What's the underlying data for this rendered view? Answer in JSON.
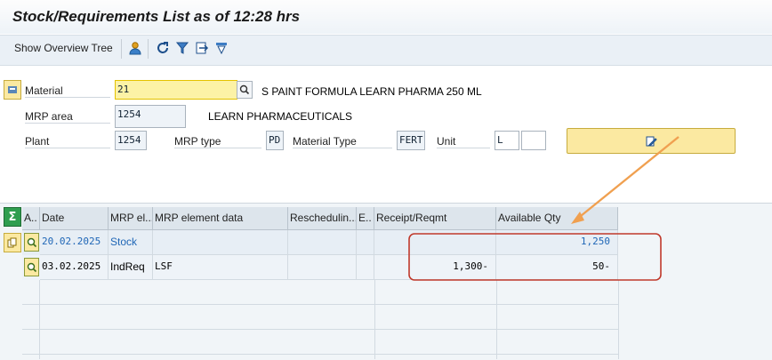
{
  "window": {
    "title": "Stock/Requirements List as of 12:28 hrs"
  },
  "toolbar": {
    "overview_tree_label": "Show Overview Tree",
    "icons": [
      "person-icon",
      "refresh-icon",
      "filter-icon",
      "export-icon",
      "settings-icon"
    ]
  },
  "header": {
    "material_label": "Material",
    "material_value": "21",
    "material_description": "S PAINT FORMULA LEARN PHARMA 250 ML",
    "mrp_area_label": "MRP area",
    "mrp_area_value": "1254",
    "mrp_area_description": "LEARN PHARMACEUTICALS",
    "plant_label": "Plant",
    "plant_value": "1254",
    "mrp_type_label": "MRP type",
    "mrp_type_value": "PD",
    "material_type_label": "Material Type",
    "material_type_value": "FERT",
    "unit_label": "Unit",
    "unit_value": "L",
    "unit_extra_value": ""
  },
  "table": {
    "columns": [
      "A..",
      "Date",
      "MRP el...",
      "MRP element data",
      "Reschedulin...",
      "E..",
      "Receipt/Reqmt",
      "Available Qty"
    ],
    "rows": [
      {
        "date": "20.02.2025",
        "mrp_element": "Stock",
        "element_data": "",
        "rescheduling": "",
        "exception": "",
        "receipt_reqmt": "",
        "available_qty": "1,250"
      },
      {
        "date": "03.02.2025",
        "mrp_element": "IndReq",
        "element_data": "LSF",
        "rescheduling": "",
        "exception": "",
        "receipt_reqmt": "1,300-",
        "available_qty": "50-"
      }
    ]
  },
  "colors": {
    "accent_yellow": "#fbe9a1",
    "highlight_red": "#c0392b",
    "arrow_orange": "#f0a050",
    "link_blue": "#1f66b6"
  }
}
